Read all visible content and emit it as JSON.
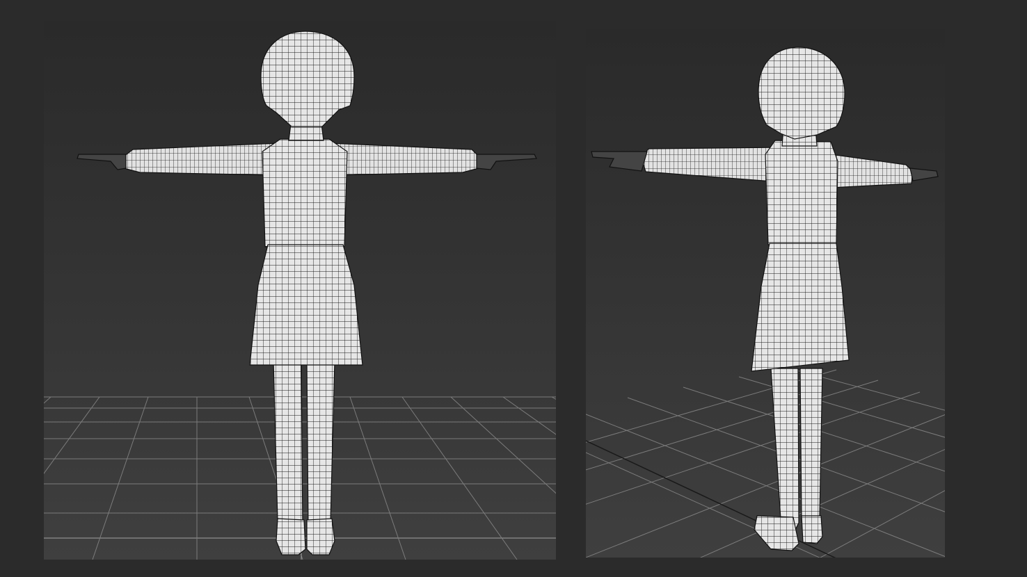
{
  "viewports": [
    {
      "view": "back",
      "model": "t-pose-character-wireframe"
    },
    {
      "view": "perspective",
      "model": "t-pose-character-wireframe"
    }
  ],
  "colors": {
    "background": "#2b2b2b",
    "viewport_top": "#2a2a2a",
    "viewport_bottom": "#3f3f3f",
    "grid": "#8a8a8a",
    "mesh_fill": "#e4e4e4",
    "wire": "#1a1a1a"
  }
}
